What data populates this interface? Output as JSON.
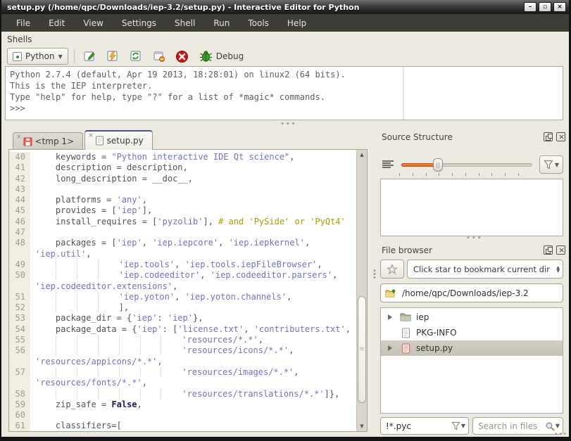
{
  "window": {
    "title": "setup.py (/home/qpc/Downloads/iep-3.2/setup.py) - Interactive Editor for Python",
    "minimize_glyph": "–",
    "maximize_glyph": "▫",
    "close_glyph": "×"
  },
  "menu": {
    "items": [
      "File",
      "Edit",
      "View",
      "Settings",
      "Shell",
      "Run",
      "Tools",
      "Help"
    ]
  },
  "shells": {
    "label": "Shells",
    "python_button_label": "Python",
    "debug_label": "Debug",
    "output_lines": [
      "Python 2.7.4 (default, Apr 19 2013, 18:28:01) on linux2 (64 bits).",
      "This is the IEP interpreter.",
      "Type \"help\" for help, type \"?\" for a list of *magic* commands.",
      ">>>"
    ]
  },
  "editor": {
    "tabs": [
      {
        "label": "<tmp 1>",
        "close_glyph": "×"
      },
      {
        "label": "setup.py",
        "close_glyph": "×"
      }
    ],
    "rows": [
      {
        "num": "40",
        "segments": [
          {
            "text": "    keywords = ",
            "style": "plain"
          },
          {
            "text": "\"Python interactive IDE Qt science\"",
            "style": "string"
          },
          {
            "text": ",",
            "style": "plain"
          }
        ]
      },
      {
        "num": "41",
        "segments": [
          {
            "text": "    description = description,",
            "style": "plain"
          }
        ]
      },
      {
        "num": "42",
        "segments": [
          {
            "text": "    long_description = __doc__,",
            "style": "plain"
          }
        ]
      },
      {
        "num": "43",
        "segments": []
      },
      {
        "num": "44",
        "segments": [
          {
            "text": "    platforms = ",
            "style": "plain"
          },
          {
            "text": "'any'",
            "style": "string"
          },
          {
            "text": ",",
            "style": "plain"
          }
        ]
      },
      {
        "num": "45",
        "segments": [
          {
            "text": "    provides = [",
            "style": "plain"
          },
          {
            "text": "'iep'",
            "style": "string"
          },
          {
            "text": "],",
            "style": "plain"
          }
        ]
      },
      {
        "num": "46",
        "segments": [
          {
            "text": "    install_requires = [",
            "style": "plain"
          },
          {
            "text": "'pyzolib'",
            "style": "string"
          },
          {
            "text": "], ",
            "style": "plain"
          },
          {
            "text": "# and 'PySide' or 'PyQt4'",
            "style": "comment"
          }
        ]
      },
      {
        "num": "47",
        "segments": []
      },
      {
        "num": "48",
        "segments": [
          {
            "text": "    packages = [",
            "style": "plain"
          },
          {
            "text": "'iep'",
            "style": "string"
          },
          {
            "text": ", ",
            "style": "plain"
          },
          {
            "text": "'iep.iepcore'",
            "style": "string"
          },
          {
            "text": ", ",
            "style": "plain"
          },
          {
            "text": "'iep.iepkernel'",
            "style": "string"
          },
          {
            "text": ",",
            "style": "plain"
          }
        ]
      },
      {
        "num": "",
        "segments": [
          {
            "text": "'iep.util'",
            "style": "string"
          },
          {
            "text": ",",
            "style": "plain"
          }
        ]
      },
      {
        "num": "49",
        "segments": [
          {
            "text": "                ",
            "style": "plain"
          },
          {
            "text": "'iep.tools'",
            "style": "string"
          },
          {
            "text": ", ",
            "style": "plain"
          },
          {
            "text": "'iep.tools.iepFileBrowser'",
            "style": "string"
          },
          {
            "text": ",",
            "style": "plain"
          }
        ]
      },
      {
        "num": "50",
        "segments": [
          {
            "text": "                ",
            "style": "plain"
          },
          {
            "text": "'iep.codeeditor'",
            "style": "string"
          },
          {
            "text": ", ",
            "style": "plain"
          },
          {
            "text": "'iep.codeeditor.parsers'",
            "style": "string"
          },
          {
            "text": ",",
            "style": "plain"
          }
        ]
      },
      {
        "num": "",
        "segments": [
          {
            "text": "'iep.codeeditor.extensions'",
            "style": "string"
          },
          {
            "text": ",",
            "style": "plain"
          }
        ]
      },
      {
        "num": "51",
        "segments": [
          {
            "text": "                ",
            "style": "plain"
          },
          {
            "text": "'iep.yoton'",
            "style": "string"
          },
          {
            "text": ", ",
            "style": "plain"
          },
          {
            "text": "'iep.yoton.channels'",
            "style": "string"
          },
          {
            "text": ",",
            "style": "plain"
          }
        ]
      },
      {
        "num": "52",
        "segments": [
          {
            "text": "                ],",
            "style": "plain"
          }
        ]
      },
      {
        "num": "53",
        "segments": [
          {
            "text": "    package_dir = {",
            "style": "plain"
          },
          {
            "text": "'iep'",
            "style": "string"
          },
          {
            "text": ": ",
            "style": "plain"
          },
          {
            "text": "'iep'",
            "style": "string"
          },
          {
            "text": "},",
            "style": "plain"
          }
        ]
      },
      {
        "num": "54",
        "segments": [
          {
            "text": "    package_data = {",
            "style": "plain"
          },
          {
            "text": "'iep'",
            "style": "string"
          },
          {
            "text": ": [",
            "style": "plain"
          },
          {
            "text": "'license.txt'",
            "style": "string"
          },
          {
            "text": ", ",
            "style": "plain"
          },
          {
            "text": "'contributers.txt'",
            "style": "string"
          },
          {
            "text": ",",
            "style": "plain"
          }
        ]
      },
      {
        "num": "55",
        "segments": [
          {
            "text": "                            ",
            "style": "plain"
          },
          {
            "text": "'resources/*.*'",
            "style": "string"
          },
          {
            "text": ",",
            "style": "plain"
          }
        ]
      },
      {
        "num": "56",
        "segments": [
          {
            "text": "                            ",
            "style": "plain"
          },
          {
            "text": "'resources/icons/*.*'",
            "style": "string"
          },
          {
            "text": ",",
            "style": "plain"
          }
        ]
      },
      {
        "num": "",
        "segments": [
          {
            "text": "'resources/appicons/*.*'",
            "style": "string"
          },
          {
            "text": ",",
            "style": "plain"
          }
        ]
      },
      {
        "num": "57",
        "segments": [
          {
            "text": "                            ",
            "style": "plain"
          },
          {
            "text": "'resources/images/*.*'",
            "style": "string"
          },
          {
            "text": ",",
            "style": "plain"
          }
        ]
      },
      {
        "num": "",
        "segments": [
          {
            "text": "'resources/fonts/*.*'",
            "style": "string"
          },
          {
            "text": ",",
            "style": "plain"
          }
        ]
      },
      {
        "num": "58",
        "segments": [
          {
            "text": "                            ",
            "style": "plain"
          },
          {
            "text": "'resources/translations/*.*'",
            "style": "string"
          },
          {
            "text": "]},",
            "style": "plain"
          }
        ]
      },
      {
        "num": "59",
        "segments": [
          {
            "text": "    zip_safe = ",
            "style": "plain"
          },
          {
            "text": "False",
            "style": "keyword"
          },
          {
            "text": ",",
            "style": "plain"
          }
        ]
      },
      {
        "num": "60",
        "segments": []
      },
      {
        "num": "61",
        "segments": [
          {
            "text": "    classifiers=[",
            "style": "plain"
          }
        ]
      }
    ]
  },
  "source_structure": {
    "title": "Source Structure"
  },
  "file_browser": {
    "title": "File browser",
    "bookmark_combo_text": "Click star to bookmark current dir",
    "path": "/home/qpc/Downloads/iep-3.2",
    "tree": {
      "item1": "iep",
      "item2": "PKG-INFO",
      "item3": "setup.py"
    },
    "filter_value": "!*.pyc",
    "search_placeholder": "Search in files"
  },
  "colors": {
    "accent_orange": "#E8601F",
    "code_plain": "#4E535F",
    "code_string": "#7173C9",
    "code_comment": "#AD9C00",
    "code_keyword": "#1A1A66",
    "menubar_bg": "#3D3C37",
    "window_bg": "#ECE9E1",
    "debug_green": "#3A9D23",
    "stop_red": "#CC1111"
  }
}
